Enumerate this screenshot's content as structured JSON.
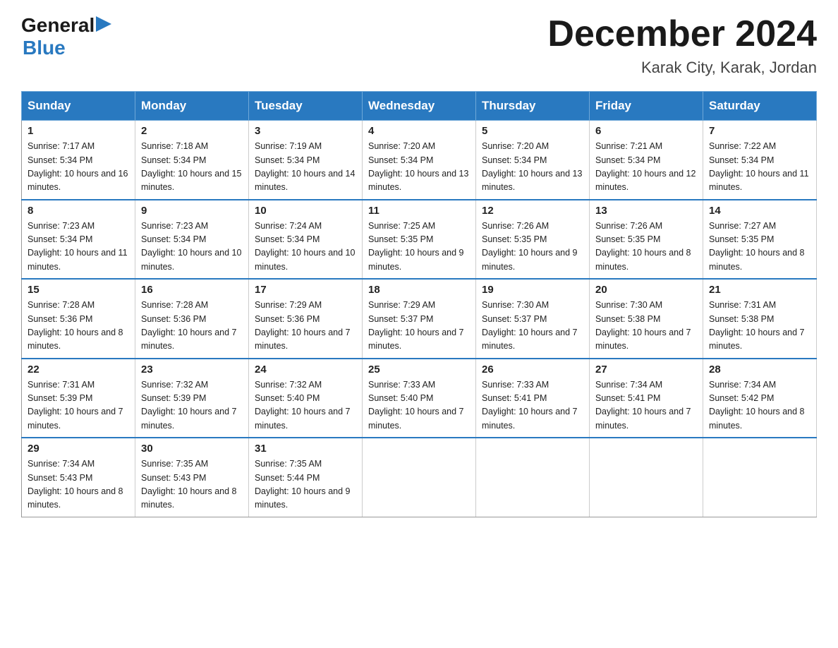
{
  "header": {
    "logo_general": "General",
    "logo_blue": "Blue",
    "month_title": "December 2024",
    "location": "Karak City, Karak, Jordan"
  },
  "days_of_week": [
    "Sunday",
    "Monday",
    "Tuesday",
    "Wednesday",
    "Thursday",
    "Friday",
    "Saturday"
  ],
  "weeks": [
    [
      {
        "day": "1",
        "sunrise": "Sunrise: 7:17 AM",
        "sunset": "Sunset: 5:34 PM",
        "daylight": "Daylight: 10 hours and 16 minutes."
      },
      {
        "day": "2",
        "sunrise": "Sunrise: 7:18 AM",
        "sunset": "Sunset: 5:34 PM",
        "daylight": "Daylight: 10 hours and 15 minutes."
      },
      {
        "day": "3",
        "sunrise": "Sunrise: 7:19 AM",
        "sunset": "Sunset: 5:34 PM",
        "daylight": "Daylight: 10 hours and 14 minutes."
      },
      {
        "day": "4",
        "sunrise": "Sunrise: 7:20 AM",
        "sunset": "Sunset: 5:34 PM",
        "daylight": "Daylight: 10 hours and 13 minutes."
      },
      {
        "day": "5",
        "sunrise": "Sunrise: 7:20 AM",
        "sunset": "Sunset: 5:34 PM",
        "daylight": "Daylight: 10 hours and 13 minutes."
      },
      {
        "day": "6",
        "sunrise": "Sunrise: 7:21 AM",
        "sunset": "Sunset: 5:34 PM",
        "daylight": "Daylight: 10 hours and 12 minutes."
      },
      {
        "day": "7",
        "sunrise": "Sunrise: 7:22 AM",
        "sunset": "Sunset: 5:34 PM",
        "daylight": "Daylight: 10 hours and 11 minutes."
      }
    ],
    [
      {
        "day": "8",
        "sunrise": "Sunrise: 7:23 AM",
        "sunset": "Sunset: 5:34 PM",
        "daylight": "Daylight: 10 hours and 11 minutes."
      },
      {
        "day": "9",
        "sunrise": "Sunrise: 7:23 AM",
        "sunset": "Sunset: 5:34 PM",
        "daylight": "Daylight: 10 hours and 10 minutes."
      },
      {
        "day": "10",
        "sunrise": "Sunrise: 7:24 AM",
        "sunset": "Sunset: 5:34 PM",
        "daylight": "Daylight: 10 hours and 10 minutes."
      },
      {
        "day": "11",
        "sunrise": "Sunrise: 7:25 AM",
        "sunset": "Sunset: 5:35 PM",
        "daylight": "Daylight: 10 hours and 9 minutes."
      },
      {
        "day": "12",
        "sunrise": "Sunrise: 7:26 AM",
        "sunset": "Sunset: 5:35 PM",
        "daylight": "Daylight: 10 hours and 9 minutes."
      },
      {
        "day": "13",
        "sunrise": "Sunrise: 7:26 AM",
        "sunset": "Sunset: 5:35 PM",
        "daylight": "Daylight: 10 hours and 8 minutes."
      },
      {
        "day": "14",
        "sunrise": "Sunrise: 7:27 AM",
        "sunset": "Sunset: 5:35 PM",
        "daylight": "Daylight: 10 hours and 8 minutes."
      }
    ],
    [
      {
        "day": "15",
        "sunrise": "Sunrise: 7:28 AM",
        "sunset": "Sunset: 5:36 PM",
        "daylight": "Daylight: 10 hours and 8 minutes."
      },
      {
        "day": "16",
        "sunrise": "Sunrise: 7:28 AM",
        "sunset": "Sunset: 5:36 PM",
        "daylight": "Daylight: 10 hours and 7 minutes."
      },
      {
        "day": "17",
        "sunrise": "Sunrise: 7:29 AM",
        "sunset": "Sunset: 5:36 PM",
        "daylight": "Daylight: 10 hours and 7 minutes."
      },
      {
        "day": "18",
        "sunrise": "Sunrise: 7:29 AM",
        "sunset": "Sunset: 5:37 PM",
        "daylight": "Daylight: 10 hours and 7 minutes."
      },
      {
        "day": "19",
        "sunrise": "Sunrise: 7:30 AM",
        "sunset": "Sunset: 5:37 PM",
        "daylight": "Daylight: 10 hours and 7 minutes."
      },
      {
        "day": "20",
        "sunrise": "Sunrise: 7:30 AM",
        "sunset": "Sunset: 5:38 PM",
        "daylight": "Daylight: 10 hours and 7 minutes."
      },
      {
        "day": "21",
        "sunrise": "Sunrise: 7:31 AM",
        "sunset": "Sunset: 5:38 PM",
        "daylight": "Daylight: 10 hours and 7 minutes."
      }
    ],
    [
      {
        "day": "22",
        "sunrise": "Sunrise: 7:31 AM",
        "sunset": "Sunset: 5:39 PM",
        "daylight": "Daylight: 10 hours and 7 minutes."
      },
      {
        "day": "23",
        "sunrise": "Sunrise: 7:32 AM",
        "sunset": "Sunset: 5:39 PM",
        "daylight": "Daylight: 10 hours and 7 minutes."
      },
      {
        "day": "24",
        "sunrise": "Sunrise: 7:32 AM",
        "sunset": "Sunset: 5:40 PM",
        "daylight": "Daylight: 10 hours and 7 minutes."
      },
      {
        "day": "25",
        "sunrise": "Sunrise: 7:33 AM",
        "sunset": "Sunset: 5:40 PM",
        "daylight": "Daylight: 10 hours and 7 minutes."
      },
      {
        "day": "26",
        "sunrise": "Sunrise: 7:33 AM",
        "sunset": "Sunset: 5:41 PM",
        "daylight": "Daylight: 10 hours and 7 minutes."
      },
      {
        "day": "27",
        "sunrise": "Sunrise: 7:34 AM",
        "sunset": "Sunset: 5:41 PM",
        "daylight": "Daylight: 10 hours and 7 minutes."
      },
      {
        "day": "28",
        "sunrise": "Sunrise: 7:34 AM",
        "sunset": "Sunset: 5:42 PM",
        "daylight": "Daylight: 10 hours and 8 minutes."
      }
    ],
    [
      {
        "day": "29",
        "sunrise": "Sunrise: 7:34 AM",
        "sunset": "Sunset: 5:43 PM",
        "daylight": "Daylight: 10 hours and 8 minutes."
      },
      {
        "day": "30",
        "sunrise": "Sunrise: 7:35 AM",
        "sunset": "Sunset: 5:43 PM",
        "daylight": "Daylight: 10 hours and 8 minutes."
      },
      {
        "day": "31",
        "sunrise": "Sunrise: 7:35 AM",
        "sunset": "Sunset: 5:44 PM",
        "daylight": "Daylight: 10 hours and 9 minutes."
      },
      null,
      null,
      null,
      null
    ]
  ]
}
